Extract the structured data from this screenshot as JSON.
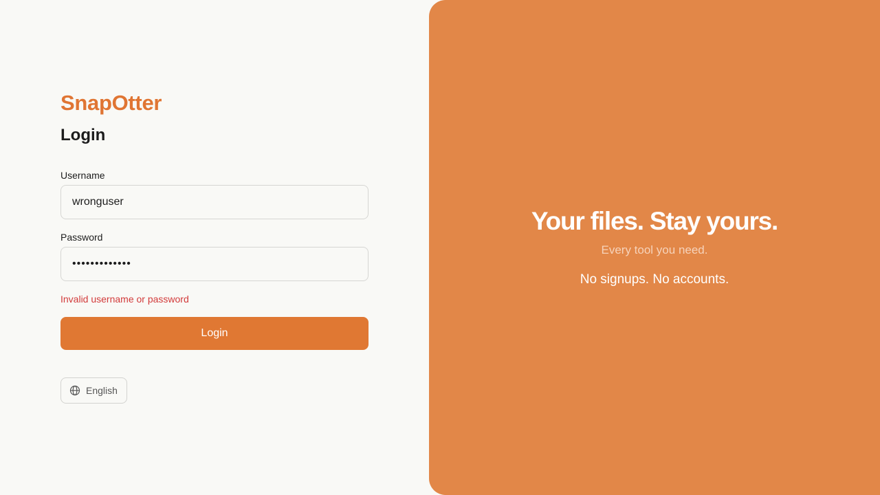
{
  "brand": {
    "name": "SnapOtter",
    "accent_color": "#e07833"
  },
  "login_form": {
    "title": "Login",
    "username_label": "Username",
    "username_value": "wronguser",
    "password_label": "Password",
    "password_value": "wrongpassword",
    "error_message": "Invalid username or password",
    "submit_label": "Login",
    "error_color": "#d23a3a"
  },
  "language_selector": {
    "icon": "globe-icon",
    "selected": "English"
  },
  "hero": {
    "headline": "Your files. Stay yours.",
    "subtitle": "Every tool you need.",
    "tagline": "No signups. No accounts.",
    "background_color": "#e28748"
  }
}
